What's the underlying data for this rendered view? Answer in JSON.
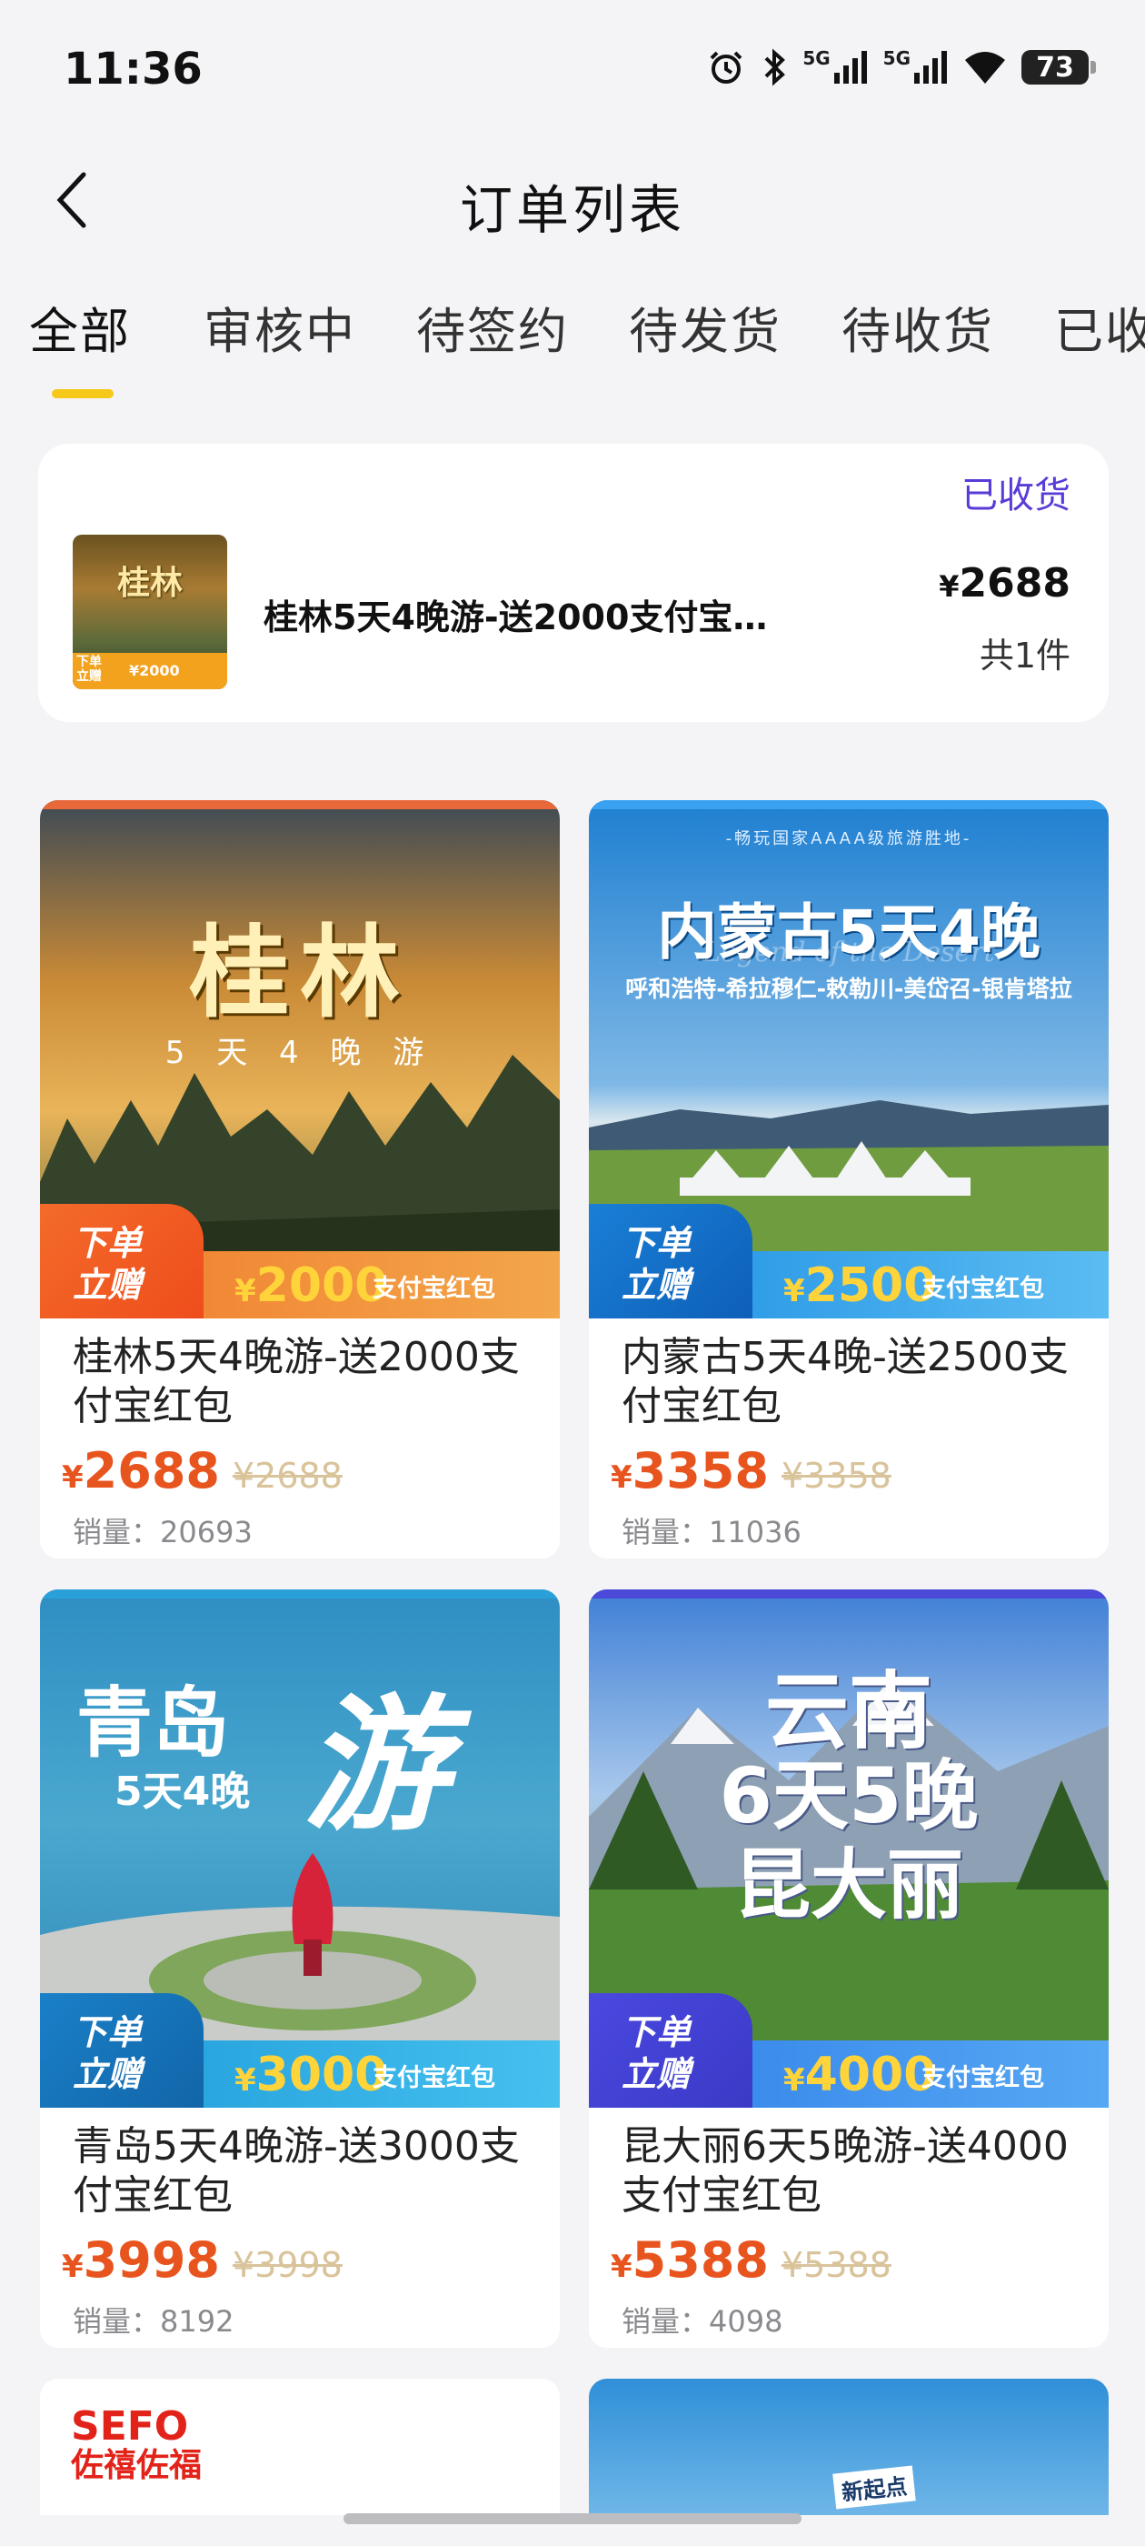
{
  "status_bar": {
    "time": "11:36",
    "battery": "73",
    "signal_1": "5G",
    "signal_2": "5G"
  },
  "header": {
    "title": "订单列表"
  },
  "tabs": [
    {
      "label": "全部",
      "active": true
    },
    {
      "label": "审核中"
    },
    {
      "label": "待签约"
    },
    {
      "label": "待发货"
    },
    {
      "label": "待收货"
    },
    {
      "label": "已收"
    }
  ],
  "order": {
    "status": "已收货",
    "name": "桂林5天4晚游-送2000支付宝…",
    "currency": "¥",
    "price": "2688",
    "quantity": "共1件",
    "thumb_title": "桂林",
    "thumb_badge": "下单\n立赠",
    "thumb_amount": "¥2000"
  },
  "products": [
    {
      "banner_title": "桂林",
      "banner_sub": "5 天 4 晚 游",
      "promo_tag": "下单\n立赠",
      "promo_currency": "¥",
      "promo_amount": "2000",
      "promo_label": "支付宝红包",
      "title": "桂林5天4晚游-送2000支付宝红包",
      "currency": "¥",
      "price": "2688",
      "original_price": "¥2688",
      "sales": "销量：20693"
    },
    {
      "banner_top": "-畅玩国家AAAA级旅游胜地-",
      "banner_title": "内蒙古5天4晚",
      "banner_sub": "呼和浩特-希拉穆仁-敕勒川-美岱召-银肯塔拉",
      "banner_script": "Legend of the Desert",
      "promo_tag": "下单\n立赠",
      "promo_currency": "¥",
      "promo_amount": "2500",
      "promo_label": "支付宝红包",
      "title": "内蒙古5天4晚-送2500支付宝红包",
      "currency": "¥",
      "price": "3358",
      "original_price": "¥3358",
      "sales": "销量：11036"
    },
    {
      "banner_title": "青岛",
      "banner_title2": "游",
      "banner_sub": "5天4晚",
      "promo_tag": "下单\n立赠",
      "promo_currency": "¥",
      "promo_amount": "3000",
      "promo_label": "支付宝红包",
      "title": "青岛5天4晚游-送3000支付宝红包",
      "currency": "¥",
      "price": "3998",
      "original_price": "¥3998",
      "sales": "销量：8192"
    },
    {
      "banner_title": "云南",
      "banner_sub": "6天5晚",
      "banner_title2": "昆大丽",
      "promo_tag": "下单\n立赠",
      "promo_currency": "¥",
      "promo_amount": "4000",
      "promo_label": "支付宝红包",
      "title": "昆大丽6天5晚游-送4000支付宝红包",
      "currency": "¥",
      "price": "5388",
      "original_price": "¥5388",
      "sales": "销量：4098"
    }
  ],
  "bottom_peek": {
    "left_logo": "SEFO",
    "left_logo_cn": "佐禧佐福",
    "right_label": "新起点"
  },
  "colors": {
    "accent": "#f6c81a",
    "price": "#e8541e",
    "status": "#5b3bd8",
    "promo_yellow": "#ffd43b"
  }
}
